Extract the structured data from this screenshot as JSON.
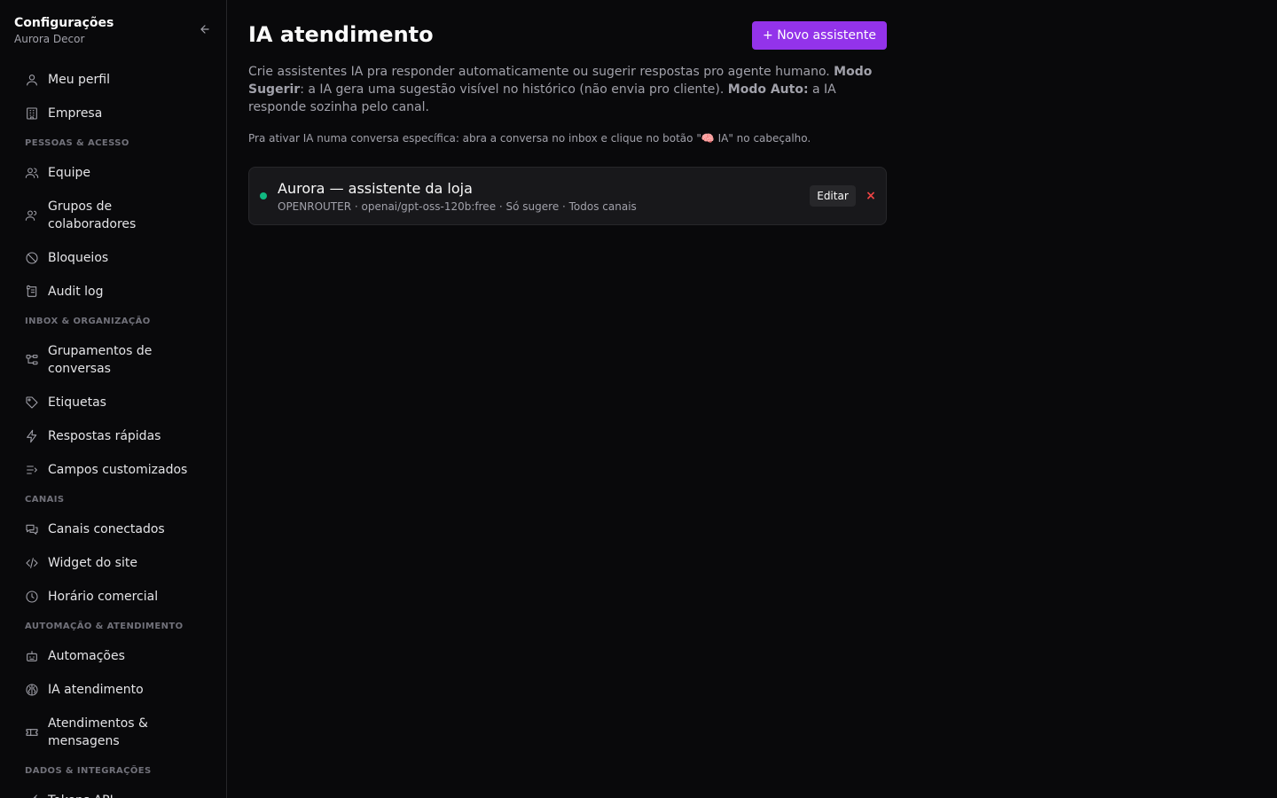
{
  "sidebar": {
    "title": "Configurações",
    "subtitle": "Aurora Decor",
    "collapse_icon": "arrow-left-icon",
    "items": [
      {
        "type": "item",
        "label": "Meu perfil",
        "icon": "user-icon",
        "name": "sidebar-item-meu-perfil"
      },
      {
        "type": "item",
        "label": "Empresa",
        "icon": "building-icon",
        "name": "sidebar-item-empresa"
      },
      {
        "type": "section",
        "label": "PESSOAS & ACESSO"
      },
      {
        "type": "item",
        "label": "Equipe",
        "icon": "users-icon",
        "name": "sidebar-item-equipe"
      },
      {
        "type": "item",
        "label": "Grupos de colaboradores",
        "icon": "user-group-icon",
        "name": "sidebar-item-grupos",
        "tall": true
      },
      {
        "type": "item",
        "label": "Bloqueios",
        "icon": "ban-icon",
        "name": "sidebar-item-bloqueios"
      },
      {
        "type": "item",
        "label": "Audit log",
        "icon": "scroll-icon",
        "name": "sidebar-item-audit-log"
      },
      {
        "type": "section",
        "label": "INBOX & ORGANIZAÇÃO"
      },
      {
        "type": "item",
        "label": "Grupamentos de conversas",
        "icon": "tree-icon",
        "name": "sidebar-item-grupamentos",
        "tall": true
      },
      {
        "type": "item",
        "label": "Etiquetas",
        "icon": "tag-icon",
        "name": "sidebar-item-etiquetas"
      },
      {
        "type": "item",
        "label": "Respostas rápidas",
        "icon": "bolt-icon",
        "name": "sidebar-item-respostas-rapidas"
      },
      {
        "type": "item",
        "label": "Campos customizados",
        "icon": "list-icon",
        "name": "sidebar-item-campos-customizados"
      },
      {
        "type": "section",
        "label": "CANAIS"
      },
      {
        "type": "item",
        "label": "Canais conectados",
        "icon": "chat-icon",
        "name": "sidebar-item-canais-conectados"
      },
      {
        "type": "item",
        "label": "Widget do site",
        "icon": "code-icon",
        "name": "sidebar-item-widget"
      },
      {
        "type": "item",
        "label": "Horário comercial",
        "icon": "clock-icon",
        "name": "sidebar-item-horario"
      },
      {
        "type": "section",
        "label": "AUTOMAÇÃO & ATENDIMENTO"
      },
      {
        "type": "item",
        "label": "Automações",
        "icon": "bot-icon",
        "name": "sidebar-item-automacoes"
      },
      {
        "type": "item",
        "label": "IA atendimento",
        "icon": "brain-icon",
        "name": "sidebar-item-ia-atendimento"
      },
      {
        "type": "item",
        "label": "Atendimentos & mensagens",
        "icon": "ticket-icon",
        "name": "sidebar-item-atendimentos",
        "tall": true
      },
      {
        "type": "section",
        "label": "DADOS & INTEGRAÇÕES"
      },
      {
        "type": "item",
        "label": "Tokens API",
        "icon": "key-icon",
        "name": "sidebar-item-tokens"
      }
    ]
  },
  "main": {
    "title": "IA atendimento",
    "new_button": "+ Novo assistente",
    "description": {
      "p1": "Crie assistentes IA pra responder automaticamente ou sugerir respostas pro agente humano. ",
      "b1": "Modo Sugerir",
      "p2": ": a IA gera uma sugestão visível no histórico (não envia pro cliente). ",
      "b2": "Modo Auto:",
      "p3": " a IA responde sozinha pelo canal."
    },
    "hint": "Pra ativar IA numa conversa específica: abra a conversa no inbox e clique no botão \"🧠 IA\" no cabeçalho.",
    "assistants": [
      {
        "name": "Aurora — assistente da loja",
        "meta": "OPENROUTER · openai/gpt-oss-120b:free · Só sugere · Todos canais",
        "status_color": "#10b981",
        "edit_label": "Editar",
        "delete_label": "×"
      }
    ]
  }
}
